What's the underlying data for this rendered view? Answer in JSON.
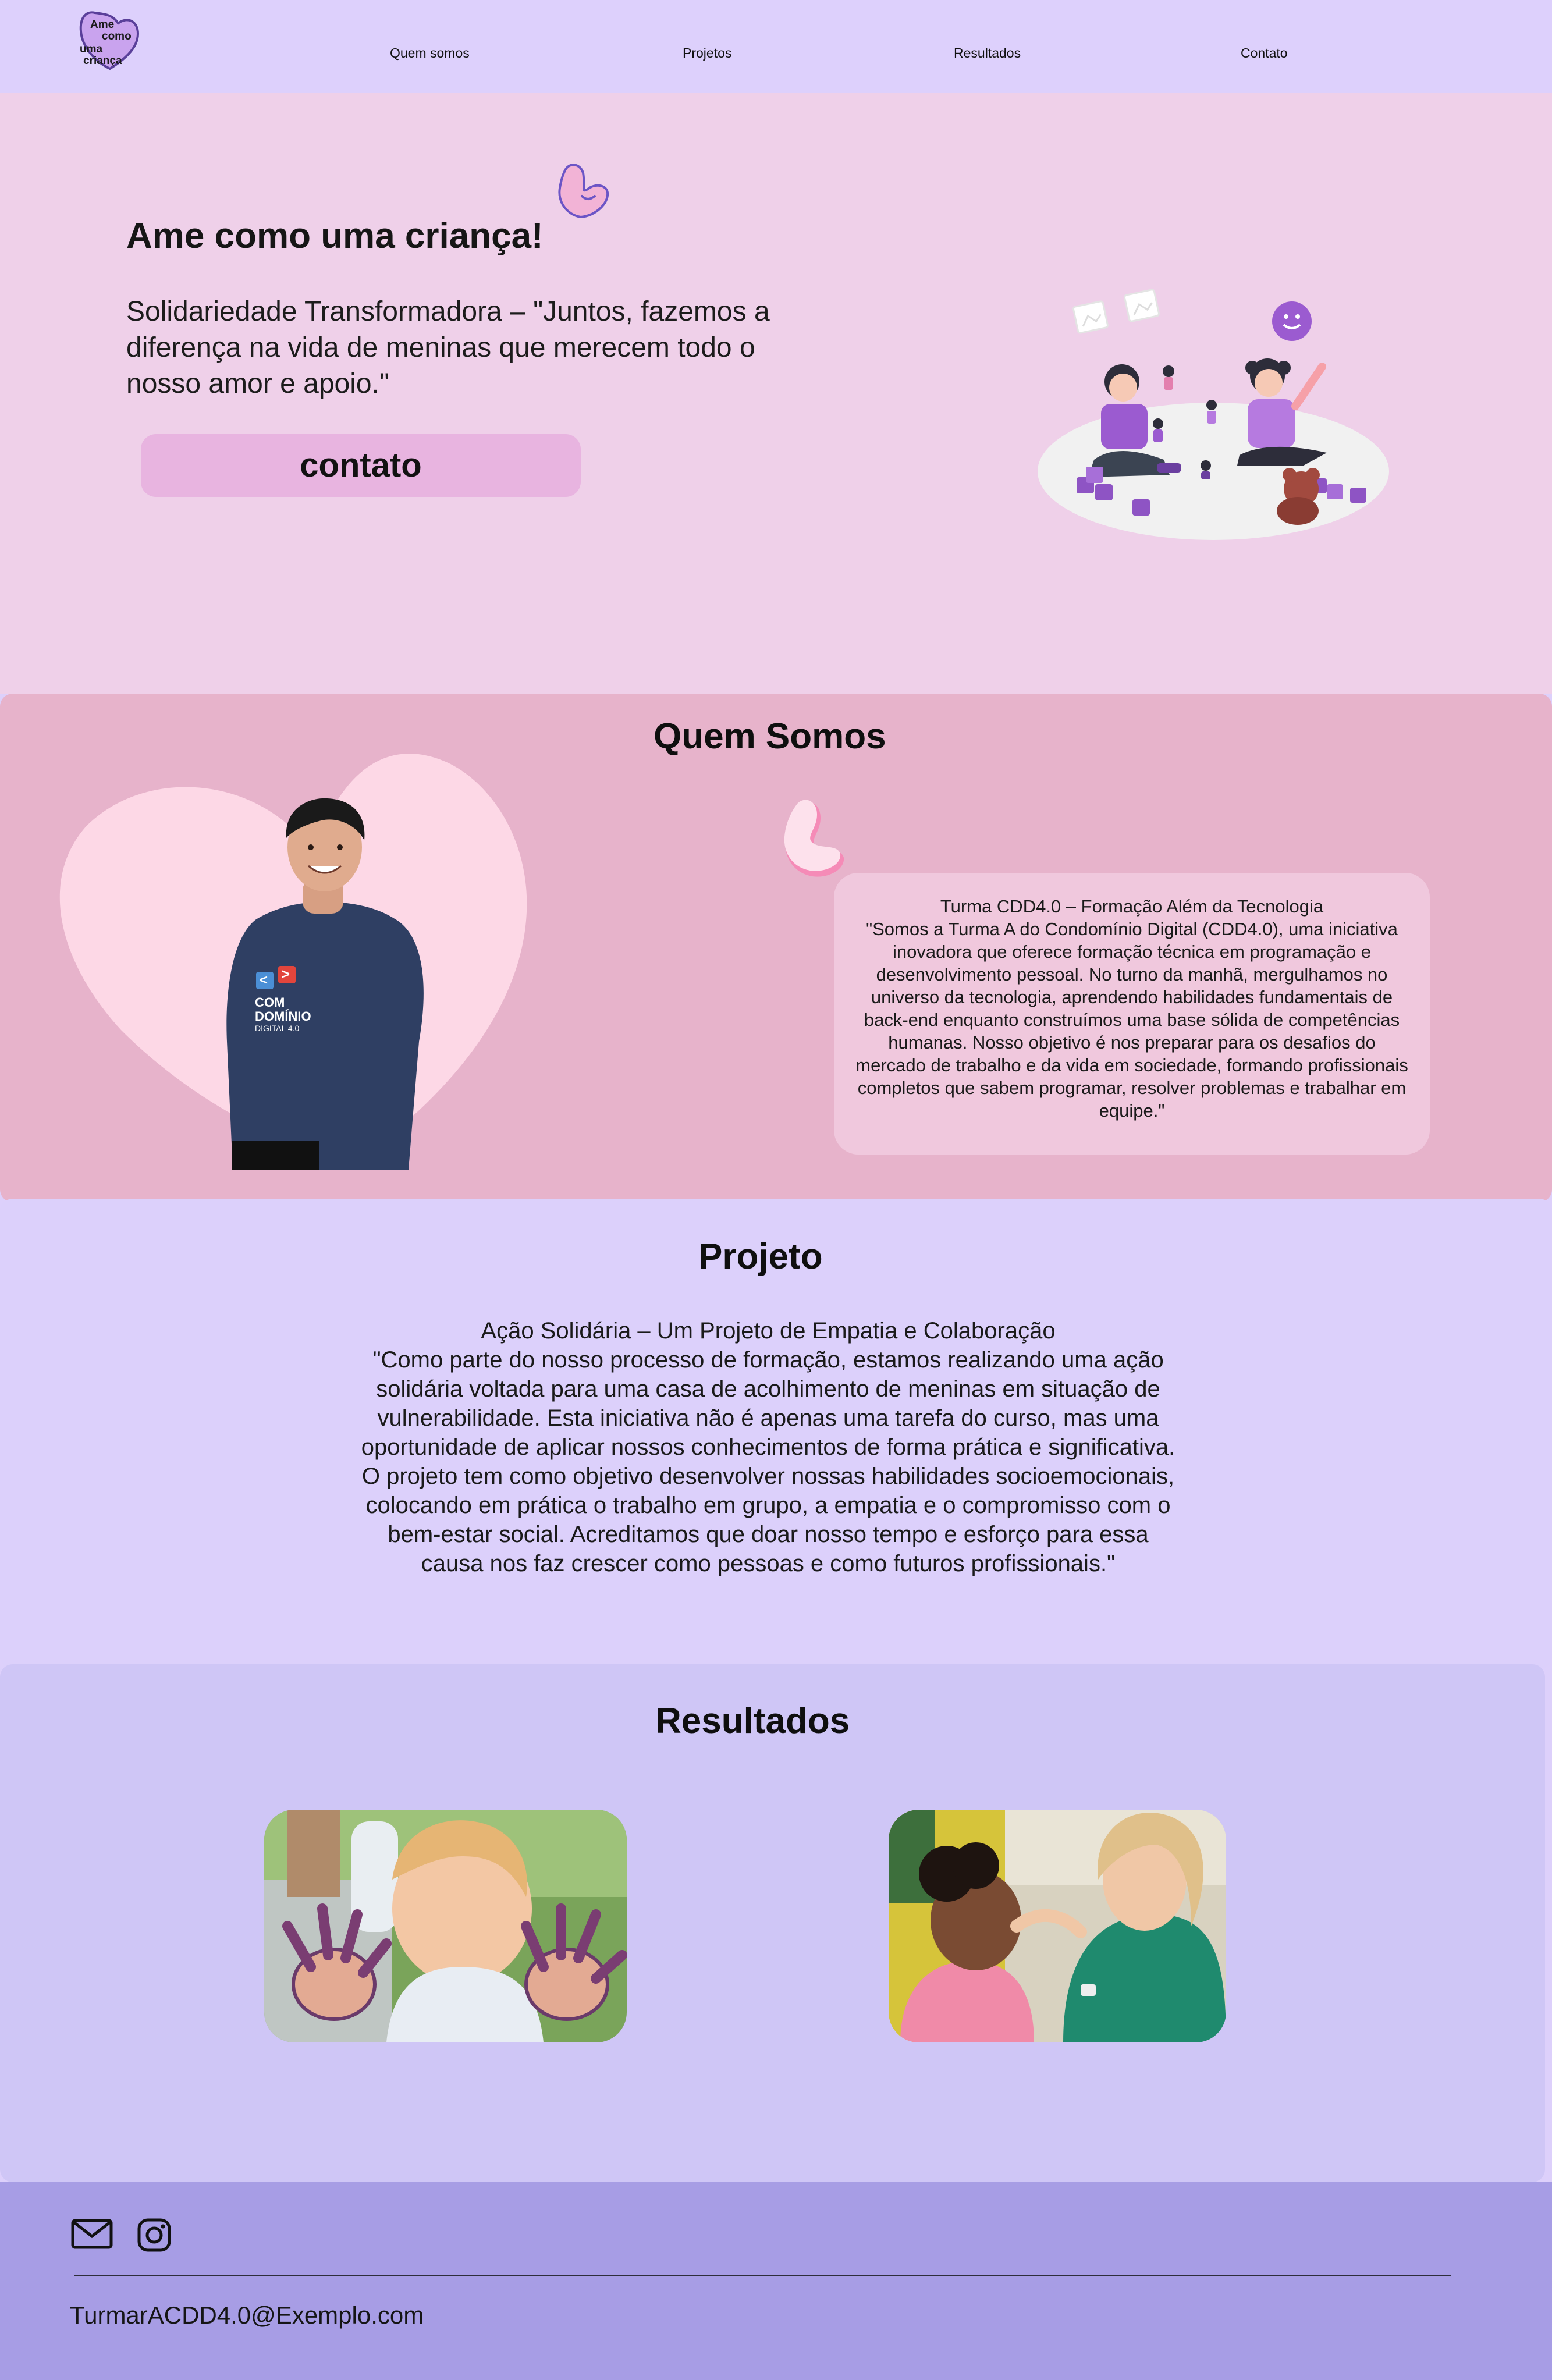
{
  "header": {
    "logo_text": "Ame como uma criança",
    "nav": [
      {
        "label": "Quem somos"
      },
      {
        "label": "Projetos"
      },
      {
        "label": "Resultados"
      },
      {
        "label": "Contato"
      }
    ]
  },
  "hero": {
    "title": "Ame como uma criança!",
    "text": "Solidariedade Transformadora – \"Juntos, fazemos a diferença na vida de meninas que merecem todo o nosso amor e apoio.\"",
    "button_label": "contato"
  },
  "about": {
    "title": "Quem Somos",
    "card_heading": "Turma CDD4.0 – Formação Além da Tecnologia",
    "card_text": "\"Somos a Turma A do Condomínio Digital (CDD4.0), uma iniciativa inovadora que oferece formação técnica em programação e desenvolvimento pessoal. No turno da manhã, mergulhamos no universo da tecnologia, aprendendo habilidades fundamentais de back-end enquanto construímos uma base sólida de competências humanas. Nosso objetivo é nos preparar para os desafios do mercado de trabalho e da vida em sociedade, formando profissionais completos que sabem programar, resolver problemas e trabalhar em equipe.\"",
    "shirt_text": [
      "COM",
      "DOMÍNIO",
      "DIGITAL 4.0"
    ]
  },
  "project": {
    "title": "Projeto",
    "heading": "Ação Solidária – Um Projeto de Empatia e Colaboração",
    "text": "\"Como parte do nosso processo de formação, estamos realizando uma ação solidária voltada para uma casa de acolhimento de meninas em situação de vulnerabilidade. Esta iniciativa não é apenas uma tarefa do curso, mas uma oportunidade de aplicar nossos conhecimentos de forma prática e significativa. O projeto tem como objetivo desenvolver nossas habilidades socioemocionais, colocando em prática o trabalho em grupo, a empatia e o compromisso com o bem-estar social. Acreditamos que doar nosso tempo e esforço para essa causa nos faz crescer como pessoas e como futuros profissionais.\""
  },
  "results": {
    "title": "Resultados"
  },
  "footer": {
    "email": "TurmarACDD4.0@Exemplo.com"
  },
  "colors": {
    "header_bg": "#ddd0fc",
    "hero_bg": "#efd0e9",
    "about_bg": "#e7b3cb",
    "project_bg": "#dcd0fb",
    "results_bg": "#cfc6f6",
    "footer_bg": "#a79de5",
    "button_bg": "#e8b4e0",
    "card_bg": "#f0c8dd"
  },
  "icons": [
    "heart-logo-icon",
    "heart-icon",
    "mail-icon",
    "instagram-icon"
  ]
}
